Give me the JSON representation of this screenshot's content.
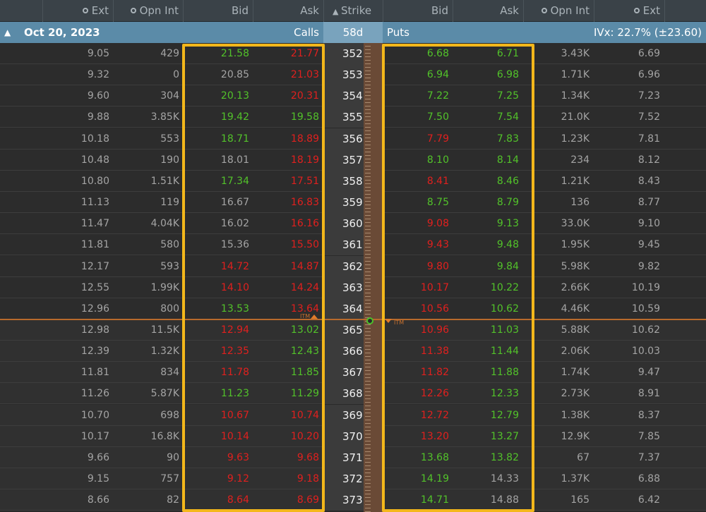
{
  "header": {
    "columns": [
      "Ext",
      "Opn Int",
      "Bid",
      "Ask",
      "Strike",
      "Bid",
      "Ask",
      "Opn Int",
      "Ext"
    ]
  },
  "series": {
    "expiration": "Oct 20, 2023",
    "calls_label": "Calls",
    "days": "58d",
    "puts_label": "Puts",
    "ivx": "IVx: 22.7% (±23.60)"
  },
  "itm_label": "ITM",
  "colors": {
    "green": "#52c22a",
    "red": "#e0201e",
    "neutral": "#a4a4a4",
    "highlight": "#f3b71b",
    "header_band": "#5b8ba8"
  },
  "rows": [
    {
      "strike": "352",
      "c_ext": "9.05",
      "c_oi": "429",
      "c_bid": "21.58",
      "c_bid_c": "g",
      "c_ask": "21.77",
      "c_ask_c": "r",
      "p_bid": "6.68",
      "p_bid_c": "g",
      "p_ask": "6.71",
      "p_ask_c": "g",
      "p_oi": "3.43K",
      "p_ext": "6.69"
    },
    {
      "strike": "353",
      "c_ext": "9.32",
      "c_oi": "0",
      "c_bid": "20.85",
      "c_bid_c": "n",
      "c_ask": "21.03",
      "c_ask_c": "r",
      "p_bid": "6.94",
      "p_bid_c": "g",
      "p_ask": "6.98",
      "p_ask_c": "g",
      "p_oi": "1.71K",
      "p_ext": "6.96"
    },
    {
      "strike": "354",
      "c_ext": "9.60",
      "c_oi": "304",
      "c_bid": "20.13",
      "c_bid_c": "g",
      "c_ask": "20.31",
      "c_ask_c": "r",
      "p_bid": "7.22",
      "p_bid_c": "g",
      "p_ask": "7.25",
      "p_ask_c": "g",
      "p_oi": "1.34K",
      "p_ext": "7.23"
    },
    {
      "strike": "355",
      "c_ext": "9.88",
      "c_oi": "3.85K",
      "c_bid": "19.42",
      "c_bid_c": "g",
      "c_ask": "19.58",
      "c_ask_c": "g",
      "p_bid": "7.50",
      "p_bid_c": "g",
      "p_ask": "7.54",
      "p_ask_c": "g",
      "p_oi": "21.0K",
      "p_ext": "7.52"
    },
    {
      "strike": "356",
      "c_ext": "10.18",
      "c_oi": "553",
      "c_bid": "18.71",
      "c_bid_c": "g",
      "c_ask": "18.89",
      "c_ask_c": "r",
      "p_bid": "7.79",
      "p_bid_c": "r",
      "p_ask": "7.83",
      "p_ask_c": "g",
      "p_oi": "1.23K",
      "p_ext": "7.81"
    },
    {
      "strike": "357",
      "c_ext": "10.48",
      "c_oi": "190",
      "c_bid": "18.01",
      "c_bid_c": "n",
      "c_ask": "18.19",
      "c_ask_c": "r",
      "p_bid": "8.10",
      "p_bid_c": "g",
      "p_ask": "8.14",
      "p_ask_c": "g",
      "p_oi": "234",
      "p_ext": "8.12"
    },
    {
      "strike": "358",
      "c_ext": "10.80",
      "c_oi": "1.51K",
      "c_bid": "17.34",
      "c_bid_c": "g",
      "c_ask": "17.51",
      "c_ask_c": "r",
      "p_bid": "8.41",
      "p_bid_c": "r",
      "p_ask": "8.46",
      "p_ask_c": "g",
      "p_oi": "1.21K",
      "p_ext": "8.43"
    },
    {
      "strike": "359",
      "c_ext": "11.13",
      "c_oi": "119",
      "c_bid": "16.67",
      "c_bid_c": "n",
      "c_ask": "16.83",
      "c_ask_c": "r",
      "p_bid": "8.75",
      "p_bid_c": "g",
      "p_ask": "8.79",
      "p_ask_c": "g",
      "p_oi": "136",
      "p_ext": "8.77"
    },
    {
      "strike": "360",
      "c_ext": "11.47",
      "c_oi": "4.04K",
      "c_bid": "16.02",
      "c_bid_c": "n",
      "c_ask": "16.16",
      "c_ask_c": "r",
      "p_bid": "9.08",
      "p_bid_c": "r",
      "p_ask": "9.13",
      "p_ask_c": "g",
      "p_oi": "33.0K",
      "p_ext": "9.10"
    },
    {
      "strike": "361",
      "c_ext": "11.81",
      "c_oi": "580",
      "c_bid": "15.36",
      "c_bid_c": "n",
      "c_ask": "15.50",
      "c_ask_c": "r",
      "p_bid": "9.43",
      "p_bid_c": "r",
      "p_ask": "9.48",
      "p_ask_c": "g",
      "p_oi": "1.95K",
      "p_ext": "9.45"
    },
    {
      "strike": "362",
      "c_ext": "12.17",
      "c_oi": "593",
      "c_bid": "14.72",
      "c_bid_c": "r",
      "c_ask": "14.87",
      "c_ask_c": "r",
      "p_bid": "9.80",
      "p_bid_c": "r",
      "p_ask": "9.84",
      "p_ask_c": "g",
      "p_oi": "5.98K",
      "p_ext": "9.82"
    },
    {
      "strike": "363",
      "c_ext": "12.55",
      "c_oi": "1.99K",
      "c_bid": "14.10",
      "c_bid_c": "r",
      "c_ask": "14.24",
      "c_ask_c": "r",
      "p_bid": "10.17",
      "p_bid_c": "r",
      "p_ask": "10.22",
      "p_ask_c": "g",
      "p_oi": "2.66K",
      "p_ext": "10.19"
    },
    {
      "strike": "364",
      "c_ext": "12.96",
      "c_oi": "800",
      "c_bid": "13.53",
      "c_bid_c": "g",
      "c_ask": "13.64",
      "c_ask_c": "r",
      "p_bid": "10.56",
      "p_bid_c": "r",
      "p_ask": "10.62",
      "p_ask_c": "g",
      "p_oi": "4.46K",
      "p_ext": "10.59"
    },
    {
      "strike": "365",
      "c_ext": "12.98",
      "c_oi": "11.5K",
      "c_bid": "12.94",
      "c_bid_c": "r",
      "c_ask": "13.02",
      "c_ask_c": "g",
      "p_bid": "10.96",
      "p_bid_c": "r",
      "p_ask": "11.03",
      "p_ask_c": "g",
      "p_oi": "5.88K",
      "p_ext": "10.62"
    },
    {
      "strike": "366",
      "c_ext": "12.39",
      "c_oi": "1.32K",
      "c_bid": "12.35",
      "c_bid_c": "r",
      "c_ask": "12.43",
      "c_ask_c": "g",
      "p_bid": "11.38",
      "p_bid_c": "r",
      "p_ask": "11.44",
      "p_ask_c": "g",
      "p_oi": "2.06K",
      "p_ext": "10.03"
    },
    {
      "strike": "367",
      "c_ext": "11.81",
      "c_oi": "834",
      "c_bid": "11.78",
      "c_bid_c": "r",
      "c_ask": "11.85",
      "c_ask_c": "g",
      "p_bid": "11.82",
      "p_bid_c": "r",
      "p_ask": "11.88",
      "p_ask_c": "g",
      "p_oi": "1.74K",
      "p_ext": "9.47"
    },
    {
      "strike": "368",
      "c_ext": "11.26",
      "c_oi": "5.87K",
      "c_bid": "11.23",
      "c_bid_c": "g",
      "c_ask": "11.29",
      "c_ask_c": "g",
      "p_bid": "12.26",
      "p_bid_c": "r",
      "p_ask": "12.33",
      "p_ask_c": "g",
      "p_oi": "2.73K",
      "p_ext": "8.91"
    },
    {
      "strike": "369",
      "c_ext": "10.70",
      "c_oi": "698",
      "c_bid": "10.67",
      "c_bid_c": "r",
      "c_ask": "10.74",
      "c_ask_c": "r",
      "p_bid": "12.72",
      "p_bid_c": "r",
      "p_ask": "12.79",
      "p_ask_c": "g",
      "p_oi": "1.38K",
      "p_ext": "8.37"
    },
    {
      "strike": "370",
      "c_ext": "10.17",
      "c_oi": "16.8K",
      "c_bid": "10.14",
      "c_bid_c": "r",
      "c_ask": "10.20",
      "c_ask_c": "r",
      "p_bid": "13.20",
      "p_bid_c": "r",
      "p_ask": "13.27",
      "p_ask_c": "g",
      "p_oi": "12.9K",
      "p_ext": "7.85"
    },
    {
      "strike": "371",
      "c_ext": "9.66",
      "c_oi": "90",
      "c_bid": "9.63",
      "c_bid_c": "r",
      "c_ask": "9.68",
      "c_ask_c": "r",
      "p_bid": "13.68",
      "p_bid_c": "g",
      "p_ask": "13.82",
      "p_ask_c": "g",
      "p_oi": "67",
      "p_ext": "7.37"
    },
    {
      "strike": "372",
      "c_ext": "9.15",
      "c_oi": "757",
      "c_bid": "9.12",
      "c_bid_c": "r",
      "c_ask": "9.18",
      "c_ask_c": "r",
      "p_bid": "14.19",
      "p_bid_c": "g",
      "p_ask": "14.33",
      "p_ask_c": "n",
      "p_oi": "1.37K",
      "p_ext": "6.88"
    },
    {
      "strike": "373",
      "c_ext": "8.66",
      "c_oi": "82",
      "c_bid": "8.64",
      "c_bid_c": "r",
      "c_ask": "8.69",
      "c_ask_c": "r",
      "p_bid": "14.71",
      "p_bid_c": "g",
      "p_ask": "14.88",
      "p_ask_c": "n",
      "p_oi": "165",
      "p_ext": "6.42"
    }
  ]
}
